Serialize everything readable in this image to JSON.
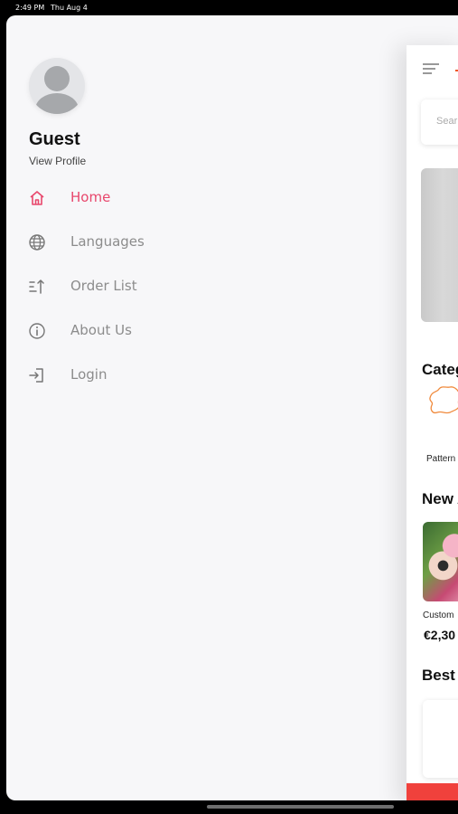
{
  "status_bar": {
    "time": "2:49 PM",
    "date": "Thu Aug 4"
  },
  "profile": {
    "name": "Guest",
    "view_profile": "View Profile"
  },
  "menu": {
    "items": [
      {
        "label": "Home",
        "icon": "home-icon",
        "active": true
      },
      {
        "label": "Languages",
        "icon": "globe-icon",
        "active": false
      },
      {
        "label": "Order List",
        "icon": "sort-icon",
        "active": false
      },
      {
        "label": "About Us",
        "icon": "info-icon",
        "active": false
      },
      {
        "label": "Login",
        "icon": "login-icon",
        "active": false
      }
    ]
  },
  "main": {
    "search_placeholder": "Sear",
    "categories_title": "Categ",
    "category_label": "Pattern",
    "new_title": "New A",
    "product_name": "Custom",
    "product_price": "€2,30",
    "best_title": "Best"
  },
  "colors": {
    "accent": "#e8476c",
    "brand": "#f05a28",
    "bottom_bar": "#f0413c",
    "menu_text": "#8c8c8c"
  }
}
